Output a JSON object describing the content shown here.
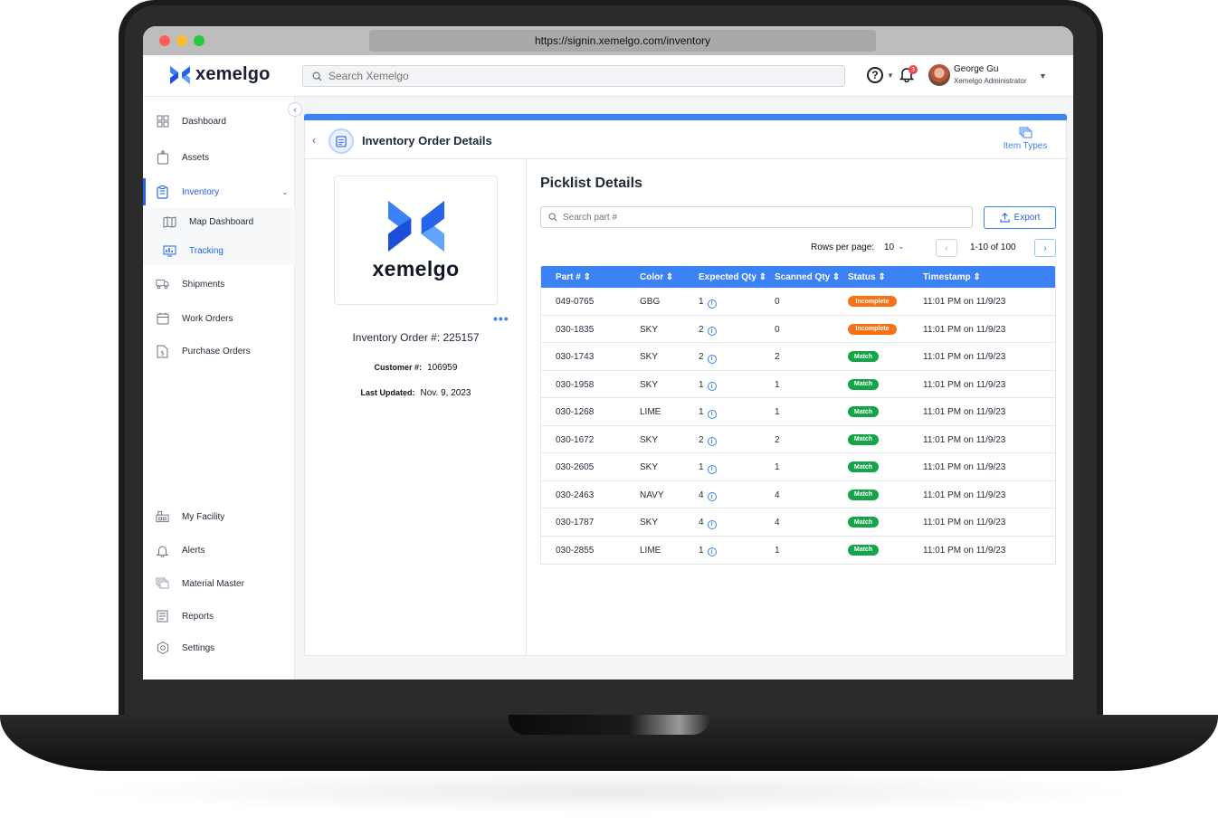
{
  "browser": {
    "url": "https://signin.xemelgo.com/inventory"
  },
  "brand": {
    "name": "xemelgo",
    "accent": "#2563eb"
  },
  "header": {
    "search_placeholder": "Search Xemelgo",
    "notification_count": "3",
    "user_name": "George Gu",
    "user_role": "Xemelgo Administrator"
  },
  "sidebar": {
    "items": [
      {
        "label": "Dashboard",
        "icon": "dashboard-icon"
      },
      {
        "label": "Assets",
        "icon": "asset-tag-icon"
      },
      {
        "label": "Inventory",
        "icon": "clipboard-icon"
      },
      {
        "label": "Map Dashboard",
        "icon": "map-icon"
      },
      {
        "label": "Tracking",
        "icon": "monitor-chart-icon"
      },
      {
        "label": "Shipments",
        "icon": "truck-icon"
      },
      {
        "label": "Work Orders",
        "icon": "calendar-icon"
      },
      {
        "label": "Purchase Orders",
        "icon": "dollar-doc-icon"
      },
      {
        "label": "My Facility",
        "icon": "facility-icon"
      },
      {
        "label": "Alerts",
        "icon": "bell-icon"
      },
      {
        "label": "Material Master",
        "icon": "layers-icon"
      },
      {
        "label": "Reports",
        "icon": "report-icon"
      },
      {
        "label": "Settings",
        "icon": "gear-icon"
      }
    ]
  },
  "page": {
    "title": "Inventory Order Details",
    "item_types_label": "Item Types"
  },
  "order": {
    "logo_text": "xemelgo",
    "order_number": "Inventory Order #: 225157",
    "customer_label": "Customer #:",
    "customer_value": "106959",
    "updated_label": "Last Updated:",
    "updated_value": "Nov. 9, 2023"
  },
  "picklist": {
    "title": "Picklist Details",
    "search_placeholder": "Search part #",
    "export_label": "Export",
    "rows_per_page_label": "Rows per page:",
    "rows_per_page_value": "10",
    "range": "1-10 of 100",
    "columns": [
      "Part #",
      "Color",
      "Expected Qty",
      "Scanned Qty",
      "Status",
      "Timestamp"
    ],
    "rows": [
      {
        "part": "049-0765",
        "color": "GBG",
        "expected": "1",
        "scanned": "0",
        "status": "Incomplete",
        "timestamp": "11:01 PM on 11/9/23"
      },
      {
        "part": "030-1835",
        "color": "SKY",
        "expected": "2",
        "scanned": "0",
        "status": "Incomplete",
        "timestamp": "11:01 PM on 11/9/23"
      },
      {
        "part": "030-1743",
        "color": "SKY",
        "expected": "2",
        "scanned": "2",
        "status": "Match",
        "timestamp": "11:01 PM on 11/9/23"
      },
      {
        "part": "030-1958",
        "color": "SKY",
        "expected": "1",
        "scanned": "1",
        "status": "Match",
        "timestamp": "11:01 PM on 11/9/23"
      },
      {
        "part": "030-1268",
        "color": "LIME",
        "expected": "1",
        "scanned": "1",
        "status": "Match",
        "timestamp": "11:01 PM on 11/9/23"
      },
      {
        "part": "030-1672",
        "color": "SKY",
        "expected": "2",
        "scanned": "2",
        "status": "Match",
        "timestamp": "11:01 PM on 11/9/23"
      },
      {
        "part": "030-2605",
        "color": "SKY",
        "expected": "1",
        "scanned": "1",
        "status": "Match",
        "timestamp": "11:01 PM on 11/9/23"
      },
      {
        "part": "030-2463",
        "color": "NAVY",
        "expected": "4",
        "scanned": "4",
        "status": "Match",
        "timestamp": "11:01 PM on 11/9/23"
      },
      {
        "part": "030-1787",
        "color": "SKY",
        "expected": "4",
        "scanned": "4",
        "status": "Match",
        "timestamp": "11:01 PM on 11/9/23"
      },
      {
        "part": "030-2855",
        "color": "LIME",
        "expected": "1",
        "scanned": "1",
        "status": "Match",
        "timestamp": "11:01 PM on 11/9/23"
      }
    ]
  },
  "status_colors": {
    "Incomplete": "#f97316",
    "Match": "#16a34a"
  }
}
